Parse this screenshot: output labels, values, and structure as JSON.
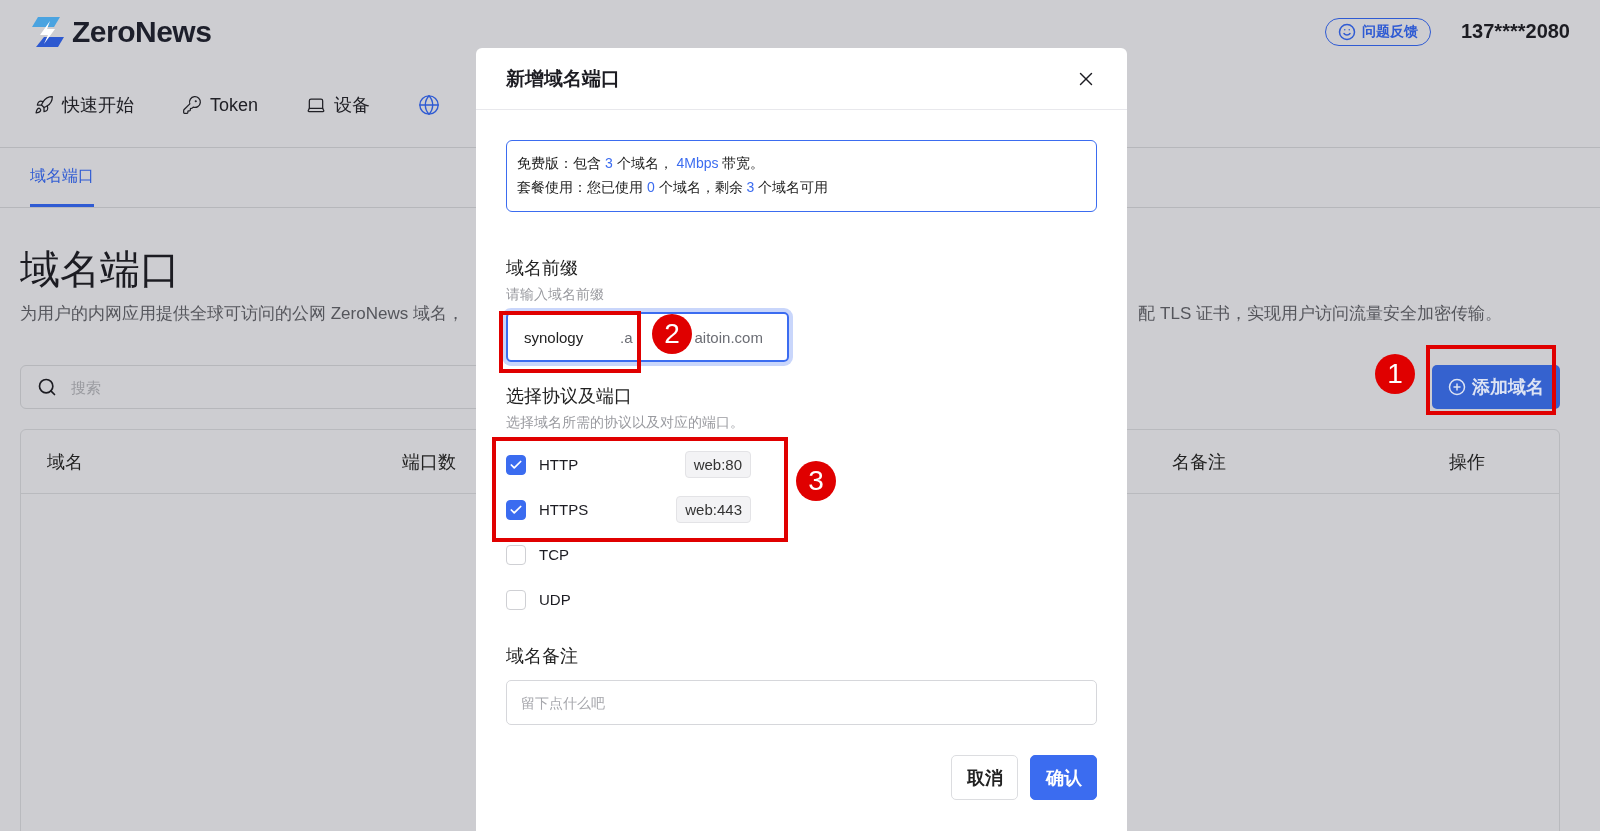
{
  "header": {
    "logo": "ZeroNews",
    "feedback": "问题反馈",
    "account": "137****2080"
  },
  "nav": [
    {
      "label": "快速开始"
    },
    {
      "label": "Token"
    },
    {
      "label": "设备"
    }
  ],
  "tabs": [
    {
      "label": "域名端口",
      "selected": true
    }
  ],
  "page": {
    "title": "域名端口",
    "description_left": "为用户的内网应用提供全球可访问的公网 ZeroNews 域名，",
    "description_right": "配 TLS 证书，实现用户访问流量安全加密传输。",
    "search_placeholder": "搜索",
    "add_button": "添加域名"
  },
  "table": {
    "columns": [
      "域名",
      "端口数",
      "名备注",
      "操作"
    ]
  },
  "dialog": {
    "title": "新增域名端口",
    "info": [
      [
        {
          "text": "免费版：包含 ",
          "accent": false
        },
        {
          "text": "3",
          "accent": true
        },
        {
          "text": " 个域名， ",
          "accent": false
        },
        {
          "text": "4Mbps",
          "accent": true
        },
        {
          "text": " 带宽。",
          "accent": false
        }
      ],
      [
        {
          "text": "套餐使用：您已使用 ",
          "accent": false
        },
        {
          "text": "0",
          "accent": true
        },
        {
          "text": " 个域名，剩余 ",
          "accent": false
        },
        {
          "text": "3",
          "accent": true
        },
        {
          "text": " 个域名可用",
          "accent": false
        }
      ]
    ],
    "prefix_label": "域名前缀",
    "prefix_hint": "请输入域名前缀",
    "prefix_value": "synology",
    "prefix_suffix": [
      ".a",
      "aitoin.com"
    ],
    "protocol_label": "选择协议及端口",
    "protocol_hint": "选择域名所需的协议以及对应的端口。",
    "protocols": [
      {
        "label": "HTTP",
        "checked": true,
        "port": "web:80"
      },
      {
        "label": "HTTPS",
        "checked": true,
        "port": "web:443"
      },
      {
        "label": "TCP",
        "checked": false
      },
      {
        "label": "UDP",
        "checked": false
      }
    ],
    "note_label": "域名备注",
    "note_placeholder": "留下点什么吧",
    "cancel": "取消",
    "confirm": "确认"
  },
  "annotations": [
    {
      "number": "1"
    },
    {
      "number": "2"
    },
    {
      "number": "3"
    }
  ]
}
